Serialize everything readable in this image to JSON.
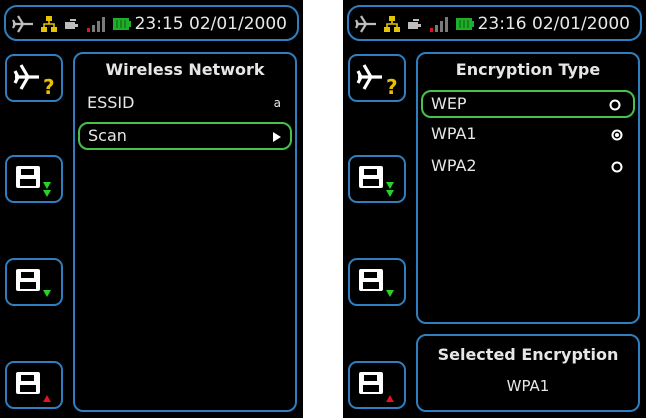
{
  "colors": {
    "accent_border": "#2f7fc0",
    "selection_border": "#46c24a",
    "text": "#e6e6e6",
    "background": "#000000"
  },
  "icons": [
    "airplane-icon",
    "network-icon",
    "battery-small-icon",
    "signal-bars-icon",
    "battery-icon",
    "help-icon",
    "save-icon",
    "arrow-down-icon",
    "arrow-up-icon",
    "play-arrow-icon",
    "radio-icon"
  ],
  "left_screen": {
    "status": {
      "time": "23:15 02/01/2000"
    },
    "panel": {
      "title": "Wireless Network",
      "items": [
        {
          "label": "ESSID",
          "value": "a"
        },
        {
          "label": "Scan"
        }
      ]
    }
  },
  "right_screen": {
    "status": {
      "time": "23:16 02/01/2000"
    },
    "panel": {
      "title": "Encryption Type",
      "options": [
        {
          "label": "WEP",
          "checked": false,
          "highlighted": true
        },
        {
          "label": "WPA1",
          "checked": true,
          "highlighted": false
        },
        {
          "label": "WPA2",
          "checked": false,
          "highlighted": false
        }
      ]
    },
    "selected_panel": {
      "title": "Selected Encryption",
      "value": "WPA1"
    }
  }
}
